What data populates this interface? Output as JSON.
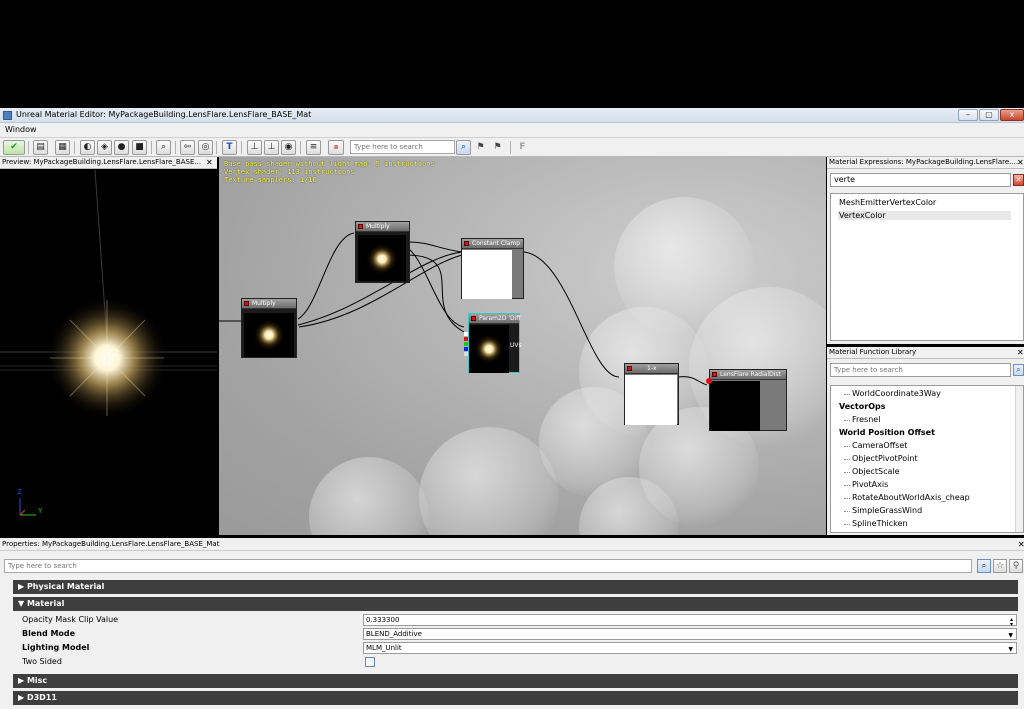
{
  "window": {
    "title": "Unreal Material Editor: MyPackageBuilding.LensFlare.LensFlare_BASE_Mat",
    "minimize": "–",
    "maximize": "▢",
    "close": "x"
  },
  "menu": {
    "window": "Window"
  },
  "toolbar": {
    "search_placeholder": "Type here to search",
    "f_label": "F"
  },
  "preview": {
    "title": "Preview: MyPackageBuilding.LensFlare.LensFlare_BASE...",
    "close": "✕",
    "axis_x": "Y",
    "axis_z": "Z"
  },
  "graph": {
    "stats": [
      "Base pass shader without light map: 5 instructions",
      "Vertex shader: 113 instructions",
      "Texture samplers: 1/16"
    ],
    "nodes": {
      "multiply_left": "Multiply",
      "multiply_top": "Multiply",
      "constant_clamp": "Constant Clamp",
      "param2d": "Param2D 'Diff",
      "one_minus": "1-x",
      "radial_dist": "LensFlare RadialDist"
    },
    "uvs_label": "UVs"
  },
  "expressions": {
    "title": "Material Expressions: MyPackageBuilding.LensFlare....",
    "close": "✕",
    "search_value": "verte",
    "clear": "✕",
    "results": [
      "MeshEmitterVertexColor",
      "VertexColor"
    ]
  },
  "function_library": {
    "title": "Material Function Library",
    "close": "✕",
    "search_placeholder": "Type here to search",
    "tree": [
      {
        "label": "WorldCoordinate3Way",
        "kind": "leaf"
      },
      {
        "label": "VectorOps",
        "kind": "cat"
      },
      {
        "label": "Fresnel",
        "kind": "leaf"
      },
      {
        "label": "World Position Offset",
        "kind": "cat"
      },
      {
        "label": "CameraOffset",
        "kind": "leaf"
      },
      {
        "label": "ObjectPivotPoint",
        "kind": "leaf"
      },
      {
        "label": "ObjectScale",
        "kind": "leaf"
      },
      {
        "label": "PivotAxis",
        "kind": "leaf"
      },
      {
        "label": "RotateAboutWorldAxis_cheap",
        "kind": "leaf"
      },
      {
        "label": "SimpleGrassWind",
        "kind": "leaf"
      },
      {
        "label": "SplineThicken",
        "kind": "leaf"
      }
    ]
  },
  "properties": {
    "title": "Properties: MyPackageBuilding.LensFlare.LensFlare_BASE_Mat",
    "close": "✕",
    "search_placeholder": "Type here to search",
    "categories": {
      "physical": "▶ Physical Material",
      "material": "▼ Material",
      "misc": "▶ Misc",
      "d3d11": "▶ D3D11"
    },
    "rows": {
      "opacity_label": "Opacity Mask Clip Value",
      "opacity_value": "0.333300",
      "blend_label": "Blend Mode",
      "blend_value": "BLEND_Additive",
      "lighting_label": "Lighting Model",
      "lighting_value": "MLM_Unlit",
      "twosided_label": "Two Sided",
      "twosided_checked": false
    }
  },
  "colors": {
    "node_header": "#8a8a8a",
    "stats_text": "#ffff55",
    "category_bar": "#3e3e3e",
    "red_pin": "#dd1111"
  }
}
